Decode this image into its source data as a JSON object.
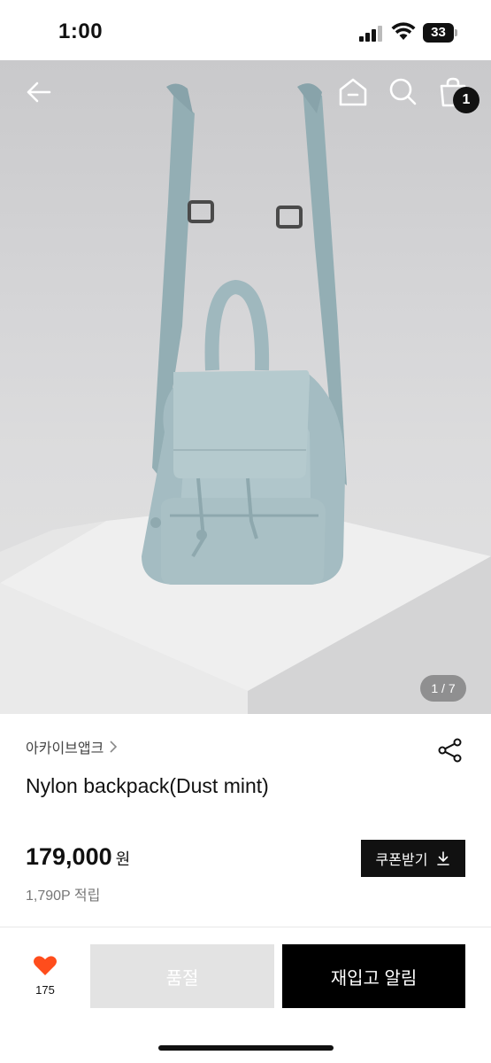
{
  "status_bar": {
    "time": "1:00",
    "battery": "33"
  },
  "hero": {
    "image_counter": "1 / 7"
  },
  "header": {
    "cart_count": "1"
  },
  "product": {
    "brand": "아카이브앱크",
    "title": "Nylon backpack(Dust mint)",
    "price": "179,000",
    "currency": "원",
    "points": "1,790P 적립",
    "coupon_label": "쿠폰받기"
  },
  "bottom_bar": {
    "like_count": "175",
    "soldout_label": "품절",
    "restock_label": "재입고 알림"
  },
  "colors": {
    "accent_heart": "#ff4d1c",
    "primary_button": "#000000",
    "disabled_button": "#e3e3e3",
    "bag_color": "#a4bcc2"
  },
  "icons": [
    "back-arrow-icon",
    "home-icon",
    "search-icon",
    "shopping-bag-icon",
    "chevron-right-icon",
    "share-icon",
    "download-icon",
    "heart-icon"
  ]
}
